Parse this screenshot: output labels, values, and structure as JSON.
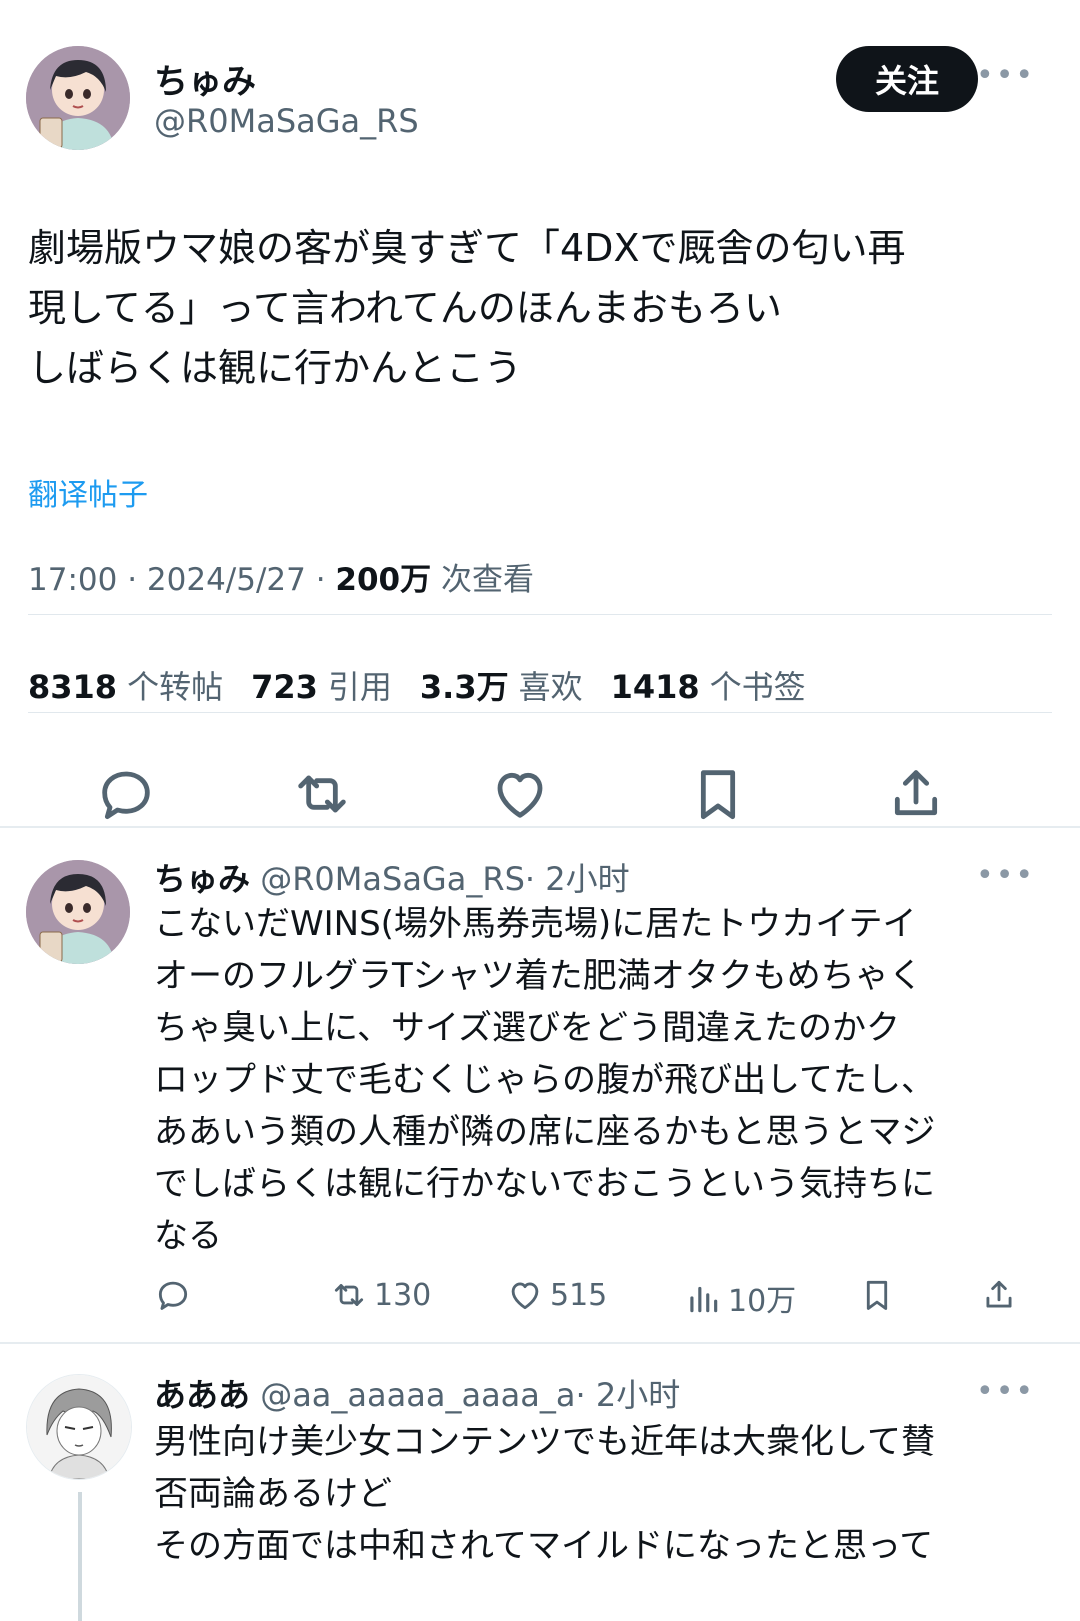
{
  "tweet": {
    "author_name": "ちゅみ",
    "author_handle": "@R0MaSaGa_RS",
    "follow_label": "关注",
    "text": "劇場版ウマ娘の客が臭すぎて「4DXで厩舎の匂い再\n現してる」って言われてんのほんまおもろい\nしばらくは観に行かんとこう",
    "translate_label": "翻译帖子",
    "time": "17:00 · 2024/5/27 · ",
    "views_count": "200万",
    "views_label": " 次查看",
    "stats": [
      {
        "num": "8318",
        "label": "个转帖"
      },
      {
        "num": "723",
        "label": "引用"
      },
      {
        "num": "3.3万",
        "label": "喜欢"
      },
      {
        "num": "1418",
        "label": "个书签"
      }
    ]
  },
  "replies": [
    {
      "author_name": "ちゅみ",
      "author_handle": "@R0MaSaGa_RS",
      "time": "· 2小时",
      "text": "こないだWINS(場外馬券売場)に居たトウカイテイ\nオーのフルグラTシャツ着た肥満オタクもめちゃく\nちゃ臭い上に、サイズ選びをどう間違えたのかク\nロップド丈で毛むくじゃらの腹が飛び出してたし、\nああいう類の人種が隣の席に座るかもと思うとマジ\nでしばらくは観に行かないでおこうという気持ちに\nなる",
      "retweets": "130",
      "likes": "515",
      "views": "10万"
    },
    {
      "author_name": "あああ",
      "author_handle": "@aa_aaaaa_aaaa_a",
      "time": "· 2小时",
      "text": "男性向け美少女コンテンツでも近年は大衆化して賛\n否両論あるけど\nその方面では中和されてマイルドになったと思って"
    }
  ],
  "icons": {
    "reply": "reply-icon",
    "retweet": "retweet-icon",
    "like": "heart-icon",
    "bookmark": "bookmark-icon",
    "share": "share-icon",
    "views": "views-icon",
    "more": "more-icon"
  },
  "colors": {
    "text": "#0f1419",
    "muted": "#536471",
    "link": "#1d9bf0",
    "button_bg": "#0f1419"
  }
}
